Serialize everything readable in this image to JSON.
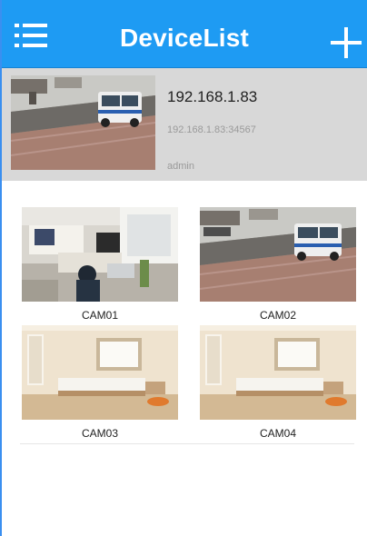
{
  "header": {
    "title": "DeviceList",
    "menu_icon": "menu-list-icon",
    "add_icon": "plus-icon",
    "background": "#1e9bf3"
  },
  "device": {
    "name": "192.168.1.83",
    "address": "192.168.1.83:34567",
    "user": "admin"
  },
  "cameras": [
    {
      "label": "CAM01",
      "scene": "office"
    },
    {
      "label": "CAM02",
      "scene": "street"
    },
    {
      "label": "CAM03",
      "scene": "bedroom"
    },
    {
      "label": "CAM04",
      "scene": "bedroom"
    }
  ]
}
